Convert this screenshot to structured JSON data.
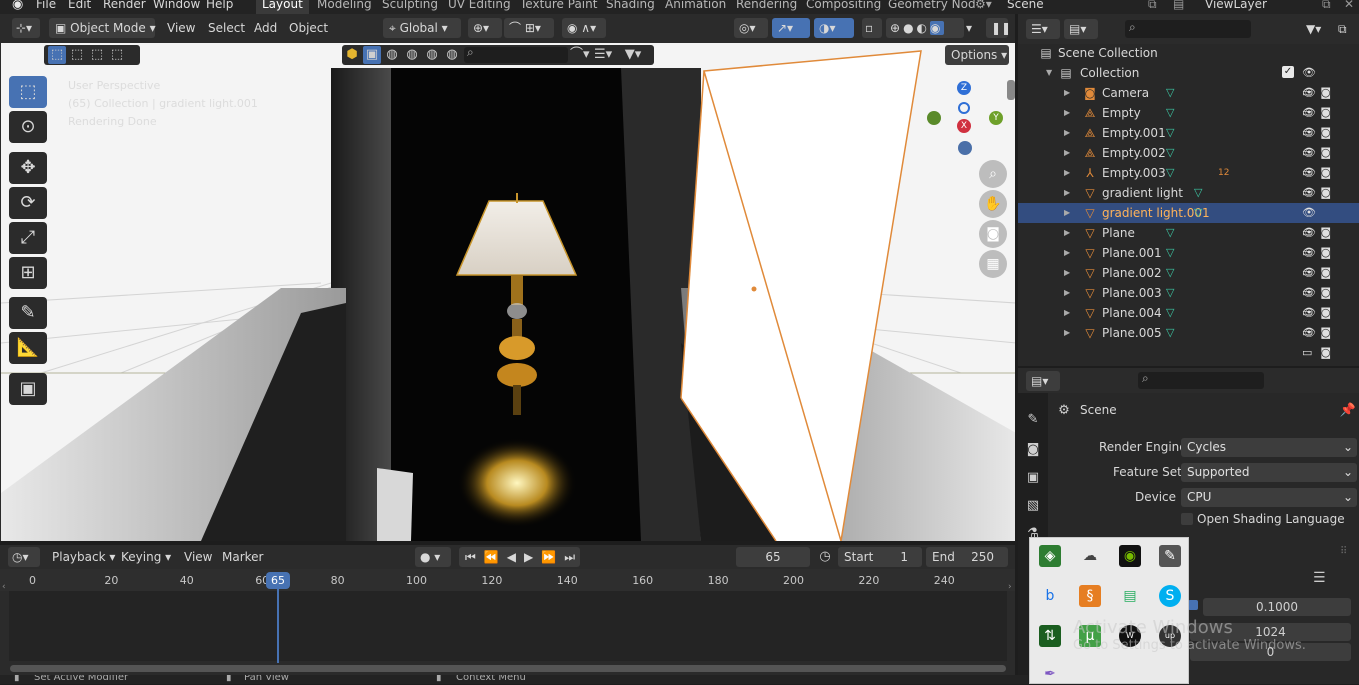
{
  "top_menu": {
    "items": [
      "File",
      "Edit",
      "Render",
      "Window",
      "Help"
    ],
    "workspaces": [
      "Layout",
      "Modeling",
      "Sculpting",
      "UV Editing",
      "Texture Paint",
      "Shading",
      "Animation",
      "Rendering",
      "Compositing",
      "Geometry Nod"
    ],
    "active_workspace": "Layout",
    "scene_label": "Scene",
    "view_layer_label": "ViewLayer"
  },
  "viewport_header": {
    "mode": "Object Mode",
    "menus": [
      "View",
      "Select",
      "Add",
      "Object"
    ],
    "transform_orientation": "Global",
    "options_label": "Options"
  },
  "viewport": {
    "info": [
      "User Perspective",
      "(65) Collection | gradient light.001",
      "Rendering Done"
    ],
    "gizmo": {
      "z": "Z",
      "x": "X",
      "y": "Y"
    }
  },
  "outliner": {
    "root": "Scene Collection",
    "collection": "Collection",
    "items": [
      {
        "name": "Camera",
        "icon": "camera-icon",
        "selected": false
      },
      {
        "name": "Empty",
        "icon": "empty-icon",
        "selected": false
      },
      {
        "name": "Empty.001",
        "icon": "empty-icon",
        "selected": false
      },
      {
        "name": "Empty.002",
        "icon": "empty-icon",
        "selected": false
      },
      {
        "name": "Empty.003",
        "icon": "armature-icon",
        "selected": false,
        "badge": "12"
      },
      {
        "name": "gradient light",
        "icon": "mesh-icon",
        "selected": false
      },
      {
        "name": "gradient light.001",
        "icon": "mesh-icon",
        "selected": true
      },
      {
        "name": "Plane",
        "icon": "mesh-icon",
        "selected": false
      },
      {
        "name": "Plane.001",
        "icon": "mesh-icon",
        "selected": false
      },
      {
        "name": "Plane.002",
        "icon": "mesh-icon",
        "selected": false
      },
      {
        "name": "Plane.003",
        "icon": "mesh-icon",
        "selected": false
      },
      {
        "name": "Plane.004",
        "icon": "mesh-icon",
        "selected": false
      },
      {
        "name": "Plane.005",
        "icon": "mesh-icon",
        "selected": false
      }
    ]
  },
  "properties": {
    "context": "Scene",
    "render_engine_label": "Render Engine",
    "render_engine_value": "Cycles",
    "feature_set_label": "Feature Set",
    "feature_set_value": "Supported",
    "device_label": "Device",
    "device_value": "CPU",
    "osl_label": "Open Shading Language",
    "value_1": "0.1000",
    "value_2": "1024",
    "value_3": "0"
  },
  "timeline": {
    "menus": [
      "Playback",
      "Keying",
      "View",
      "Marker"
    ],
    "current_frame": "65",
    "start_label": "Start",
    "start_value": "1",
    "end_label": "End",
    "end_value": "250",
    "ticks": [
      "0",
      "20",
      "40",
      "60",
      "80",
      "100",
      "120",
      "140",
      "160",
      "180",
      "200",
      "220",
      "240"
    ],
    "playhead": "65"
  },
  "status_bar": {
    "items": [
      "Set Active Modifier",
      "Pan View",
      "Context Menu"
    ]
  },
  "watermark": {
    "line1": "Activate Windows",
    "line2": "Go to Settings to activate Windows."
  },
  "tray_popup_icons": [
    "shield-icon",
    "cloud-off-icon",
    "nvidia-icon",
    "pen-icon",
    "bing-icon",
    "sublime-icon",
    "network-icon",
    "skype-icon",
    "transfer-icon",
    "utorrent-icon",
    "wacom-icon",
    "upwork-icon",
    "feather-icon"
  ]
}
